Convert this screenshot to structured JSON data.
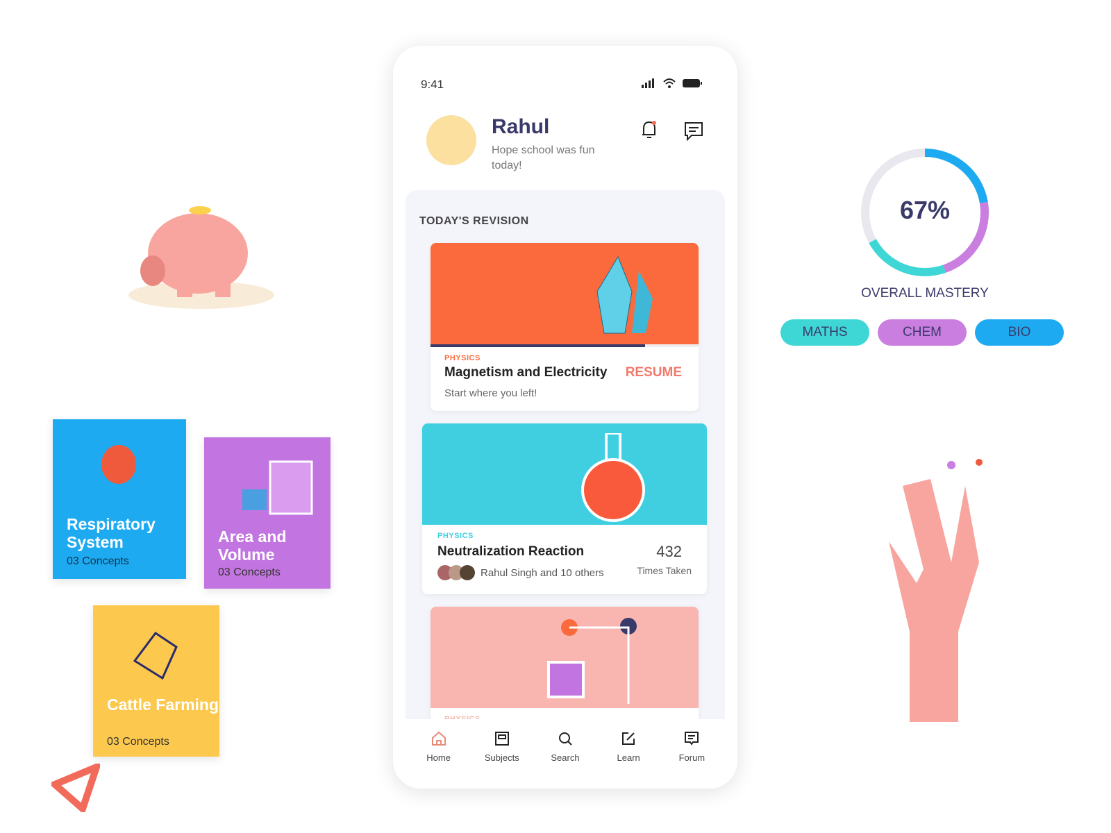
{
  "status_bar": {
    "time": "9:41",
    "icons": [
      "signal-icon",
      "wifi-icon",
      "battery-icon"
    ]
  },
  "header": {
    "name": "Rahul",
    "greeting": "Hope school was fun today!"
  },
  "revision": {
    "title": "TODAY'S REVISION",
    "cards": [
      {
        "tag": "PHYSICS",
        "title": "Magnetism and Electricity",
        "subtitle": "Start where you left!",
        "action": "RESUME",
        "progress": 0.8,
        "color": "#fa6a3c"
      },
      {
        "tag": "PHYSICS",
        "title": "Neutralization Reaction",
        "people": "Rahul Singh and 10 others",
        "count": "432",
        "count_label": "Times Taken",
        "color": "#3fcfe0"
      },
      {
        "tag": "PHYSICS",
        "color": "#f9b5b0"
      }
    ]
  },
  "nav": [
    {
      "label": "Home",
      "icon": "home-icon",
      "active": true
    },
    {
      "label": "Subjects",
      "icon": "subjects-icon"
    },
    {
      "label": "Search",
      "icon": "search-icon"
    },
    {
      "label": "Learn",
      "icon": "edit-icon"
    },
    {
      "label": "Forum",
      "icon": "forum-icon"
    }
  ],
  "mastery": {
    "value": "67%",
    "percent": 67,
    "label": "OVERALL MASTERY",
    "subjects": [
      {
        "label": "MATHS",
        "color": "#3fd6d6"
      },
      {
        "label": "CHEM",
        "color": "#c97ee0"
      },
      {
        "label": "BIO",
        "color": "#1eaaf0"
      }
    ]
  },
  "tiles": [
    {
      "title": "Respiratory System",
      "sub": "03 Concepts",
      "color": "#1eaaf0"
    },
    {
      "title": "Area and Volume",
      "sub": "03 Concepts",
      "color": "#c274e0"
    },
    {
      "title": "Cattle Farming",
      "sub": "03 Concepts",
      "color": "#fcc84e"
    }
  ]
}
